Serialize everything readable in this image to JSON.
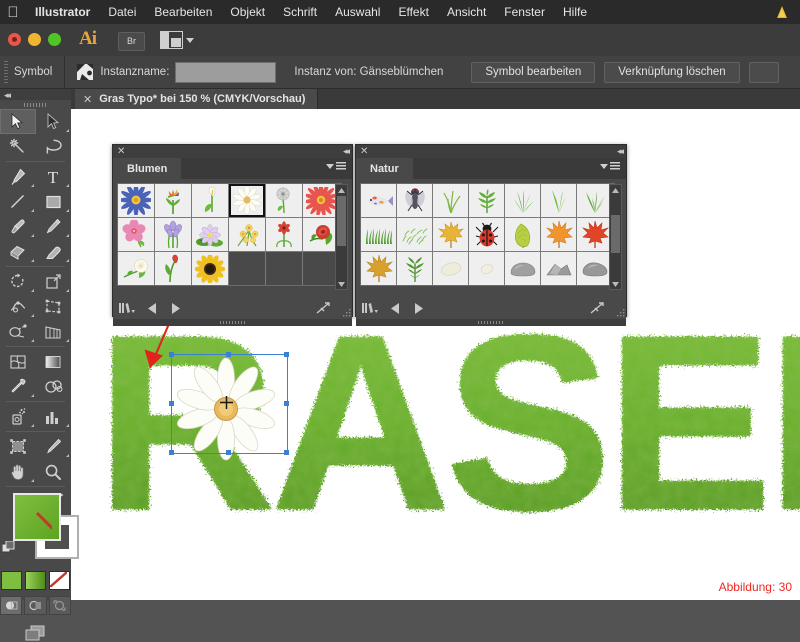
{
  "menubar": {
    "apple_icon": "apple-logo",
    "items": [
      {
        "label": "Illustrator",
        "bold": true
      },
      {
        "label": "Datei",
        "bold": false
      },
      {
        "label": "Bearbeiten",
        "bold": false
      },
      {
        "label": "Objekt",
        "bold": false
      },
      {
        "label": "Schrift",
        "bold": false
      },
      {
        "label": "Auswahl",
        "bold": false
      },
      {
        "label": "Effekt",
        "bold": false
      },
      {
        "label": "Ansicht",
        "bold": false
      },
      {
        "label": "Fenster",
        "bold": false
      },
      {
        "label": "Hilfe",
        "bold": false
      }
    ],
    "warning_icon": "warning-triangle-icon"
  },
  "appbar": {
    "app_logo": "Ai",
    "bridge_label": "Br",
    "arrange_icon": "arrange-documents-icon",
    "window_buttons": [
      "close",
      "minimize",
      "zoom"
    ]
  },
  "controlbar": {
    "panel_label": "Symbol",
    "symbol_icon": "symbol-thumbnail-icon",
    "instance_name_label": "Instanzname:",
    "instance_name_value": "",
    "instance_of_label": "Instanz von: Gänseblümchen",
    "edit_symbol_button": "Symbol bearbeiten",
    "break_link_button": "Verknüpfung löschen"
  },
  "document": {
    "tab_title": "Gras Typo* bei 150 % (CMYK/Vorschau)",
    "close_icon": "close-tab-icon"
  },
  "toolbar": {
    "collapse_icon": "collapse-panel-icon",
    "tools": [
      {
        "name": "selection-tool",
        "selected": true,
        "corner": false
      },
      {
        "name": "direct-selection-tool",
        "selected": false,
        "corner": true
      },
      {
        "name": "magic-wand-tool",
        "selected": false,
        "corner": false
      },
      {
        "name": "lasso-tool",
        "selected": false,
        "corner": false
      },
      {
        "name": "pen-tool",
        "selected": false,
        "corner": true
      },
      {
        "name": "type-tool",
        "selected": false,
        "corner": true
      },
      {
        "name": "line-segment-tool",
        "selected": false,
        "corner": true
      },
      {
        "name": "rectangle-tool",
        "selected": false,
        "corner": true
      },
      {
        "name": "paintbrush-tool",
        "selected": false,
        "corner": true
      },
      {
        "name": "pencil-tool",
        "selected": false,
        "corner": true
      },
      {
        "name": "shape-builder-tool",
        "selected": false,
        "corner": true
      },
      {
        "name": "eraser-tool",
        "selected": false,
        "corner": true
      },
      {
        "name": "rotate-tool",
        "selected": false,
        "corner": true
      },
      {
        "name": "scale-tool",
        "selected": false,
        "corner": true
      },
      {
        "name": "width-tool",
        "selected": false,
        "corner": true
      },
      {
        "name": "free-transform-tool",
        "selected": false,
        "corner": false
      },
      {
        "name": "shape-blend-tool",
        "selected": false,
        "corner": true
      },
      {
        "name": "perspective-grid-tool",
        "selected": false,
        "corner": true
      },
      {
        "name": "mesh-tool",
        "selected": false,
        "corner": false
      },
      {
        "name": "gradient-tool",
        "selected": false,
        "corner": false
      },
      {
        "name": "eyedropper-tool",
        "selected": false,
        "corner": true
      },
      {
        "name": "blend-tool",
        "selected": false,
        "corner": false
      },
      {
        "name": "symbol-sprayer-tool",
        "selected": false,
        "corner": true
      },
      {
        "name": "column-graph-tool",
        "selected": false,
        "corner": true
      },
      {
        "name": "artboard-tool",
        "selected": false,
        "corner": false
      },
      {
        "name": "slice-tool",
        "selected": false,
        "corner": true
      },
      {
        "name": "hand-tool",
        "selected": false,
        "corner": true
      },
      {
        "name": "zoom-tool",
        "selected": false,
        "corner": false
      }
    ],
    "fill_color": "#6cb22e",
    "stroke_color": "none",
    "swap_icon": "swap-fill-stroke-icon",
    "default_icon": "default-fill-stroke-icon",
    "color_modes": [
      "color-swatch",
      "gradient-swatch",
      "none-swatch"
    ],
    "draw_modes": [
      "draw-normal",
      "draw-behind",
      "draw-inside"
    ],
    "screen_mode": "change-screen-mode-icon"
  },
  "panels": [
    {
      "id": "blumen",
      "title": "Blumen",
      "columns": 6,
      "selected_index": 3,
      "symbols": [
        {
          "name": "blue-aster-flower"
        },
        {
          "name": "bird-of-paradise-flower"
        },
        {
          "name": "white-calla-lily"
        },
        {
          "name": "white-daisy"
        },
        {
          "name": "dandelion-seedhead"
        },
        {
          "name": "red-gerbera-daisy"
        },
        {
          "name": "pink-hibiscus"
        },
        {
          "name": "purple-iris"
        },
        {
          "name": "water-lily"
        },
        {
          "name": "yellow-orchid-spray"
        },
        {
          "name": "small-red-poppy"
        },
        {
          "name": "red-rose"
        },
        {
          "name": "white-rose"
        },
        {
          "name": "red-tulip-bud"
        },
        {
          "name": "sunflower"
        }
      ],
      "footer_icons": [
        "symbol-libraries-menu-icon",
        "previous-symbol-icon",
        "next-symbol-icon",
        "break-link-to-symbol-icon"
      ]
    },
    {
      "id": "natur",
      "title": "Natur",
      "columns": 7,
      "selected_index": -1,
      "symbols": [
        {
          "name": "koi-fish"
        },
        {
          "name": "housefly"
        },
        {
          "name": "thin-grass-blades"
        },
        {
          "name": "green-fern-sprig"
        },
        {
          "name": "grass-tuft-1"
        },
        {
          "name": "grass-tuft-2"
        },
        {
          "name": "grass-tuft-3"
        },
        {
          "name": "grass-row"
        },
        {
          "name": "scattered-grass-specks"
        },
        {
          "name": "yellow-maple-leaf"
        },
        {
          "name": "ladybug"
        },
        {
          "name": "green-leaf"
        },
        {
          "name": "orange-maple-leaf"
        },
        {
          "name": "red-maple-leaf"
        },
        {
          "name": "golden-maple-leaf"
        },
        {
          "name": "green-oak-leaf"
        },
        {
          "name": "white-pebble"
        },
        {
          "name": "small-pebble"
        },
        {
          "name": "grey-stone-1"
        },
        {
          "name": "grey-stone-2"
        },
        {
          "name": "grey-stone-3"
        }
      ],
      "footer_icons": [
        "symbol-libraries-menu-icon",
        "previous-symbol-icon",
        "next-symbol-icon",
        "break-link-to-symbol-icon"
      ]
    }
  ],
  "canvas": {
    "artwork_text": "RASEN",
    "artwork_style": "grass-texture-lettering",
    "grass_color": "#6cb22e",
    "selected_object": "white-daisy-symbol-instance",
    "pointer_arrow": "red-drag-arrow",
    "caption": "Abbildung: 30",
    "caption_color": "#ee2a22"
  }
}
